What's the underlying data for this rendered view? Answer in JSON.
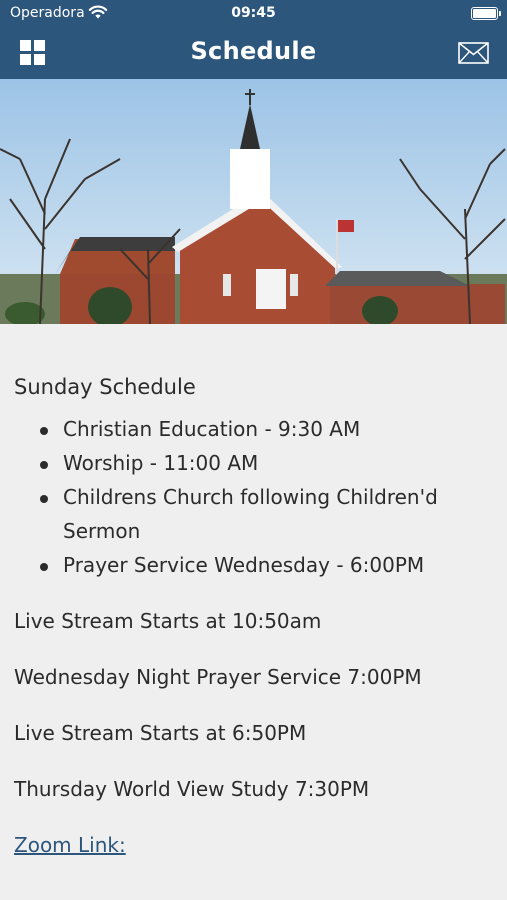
{
  "status_bar": {
    "carrier": "Operadora",
    "time": "09:45"
  },
  "header": {
    "title": "Schedule",
    "menu_icon": "grid-menu-icon",
    "mail_icon": "envelope-icon",
    "color": "#2d567c"
  },
  "schedule": {
    "heading": "Sunday Schedule",
    "items": [
      "Christian Education - 9:30 AM",
      "Worship - 11:00 AM",
      "Childrens Church following Children'd Sermon",
      "Prayer Service Wednesday - 6:00PM"
    ],
    "lines": [
      "Live Stream Starts at 10:50am",
      "Wednesday Night Prayer Service 7:00PM",
      "Live Stream Starts at 6:50PM",
      "Thursday World View Study 7:30PM"
    ],
    "zoom_link": "Zoom Link:"
  }
}
